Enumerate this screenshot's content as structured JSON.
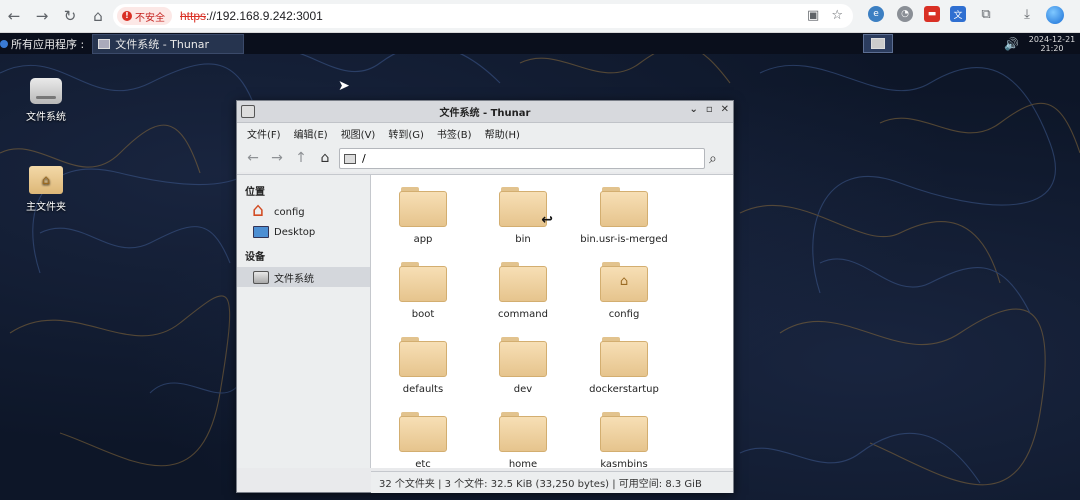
{
  "browser": {
    "security_label": "不安全",
    "url_scheme": "https",
    "url_rest": "://192.168.9.242:3001"
  },
  "taskbar": {
    "apps_menu_label": "所有应用程序 :",
    "task_title": "文件系统 - Thunar",
    "date": "2024-12-21",
    "time": "21:20"
  },
  "desktop_icons": [
    {
      "label": "文件系统",
      "icon": "drive-icon"
    },
    {
      "label": "主文件夹",
      "icon": "home-folder-icon"
    }
  ],
  "window": {
    "title": "文件系统 - Thunar",
    "menu": [
      "文件(F)",
      "编辑(E)",
      "视图(V)",
      "转到(G)",
      "书签(B)",
      "帮助(H)"
    ],
    "location_path": "/",
    "sidebar": {
      "places_heading": "位置",
      "places": [
        "config",
        "Desktop"
      ],
      "devices_heading": "设备",
      "devices": [
        "文件系统"
      ]
    },
    "files": [
      "app",
      "bin",
      "bin.usr-is-merged",
      "boot",
      "command",
      "config",
      "defaults",
      "dev",
      "dockerstartup",
      "etc",
      "home",
      "kasmbins"
    ],
    "status": "32 个文件夹 | 3 个文件: 32.5 KiB (33,250 bytes) | 可用空间: 8.3 GiB"
  },
  "colors": {
    "desktop_bg": "#0d1628",
    "folder": "#f2d6a6",
    "insecure_red": "#d93025"
  }
}
